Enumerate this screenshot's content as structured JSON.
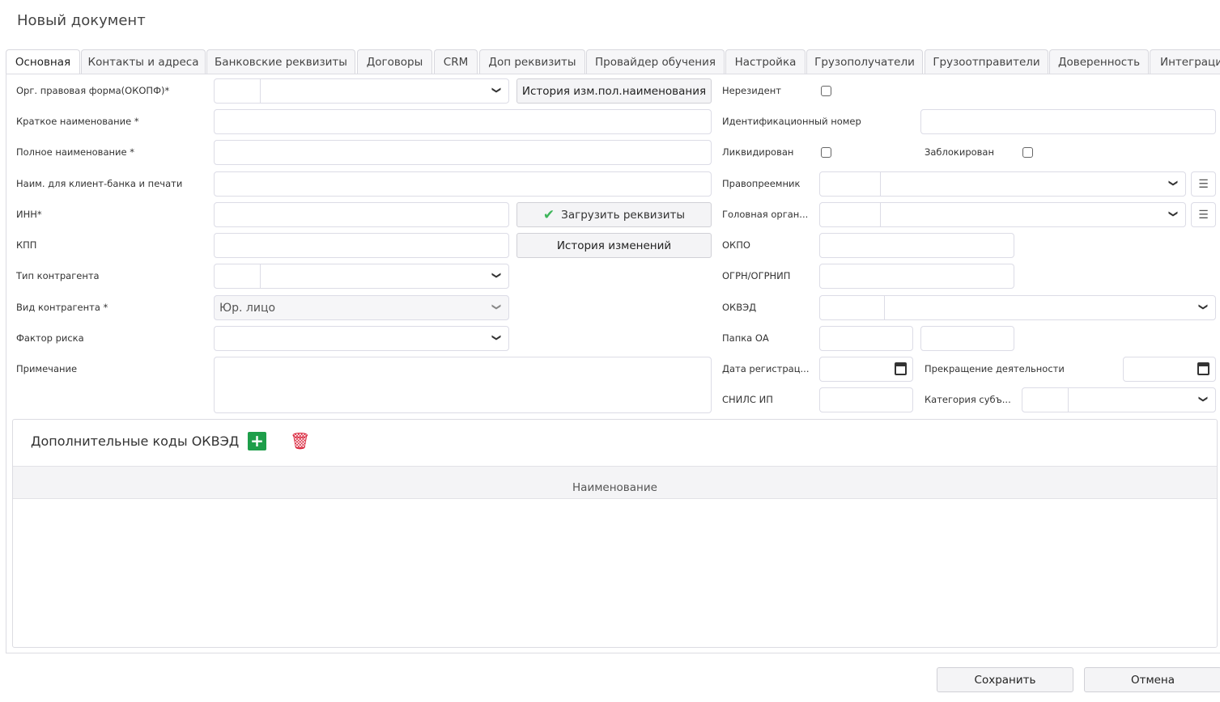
{
  "window": {
    "title": "Новый документ"
  },
  "tabs": [
    "Основная",
    "Контакты и адреса",
    "Банковские реквизиты",
    "Договоры",
    "CRM",
    "Доп реквизиты",
    "Провайдер обучения",
    "Настройка",
    "Грузополучатели",
    "Грузоотправители",
    "Доверенность",
    "Интеграци"
  ],
  "left": {
    "okopf": "Орг. правовая форма(ОКОПФ)*",
    "short_name": "Краткое наименование *",
    "full_name": "Полное наименование *",
    "bank_name": "Наим. для клиент-банка и печати",
    "inn": "ИНН*",
    "kpp": "КПП",
    "type": "Тип контрагента",
    "kind": "Вид контрагента *",
    "kind_value": "Юр. лицо",
    "risk": "Фактор риска",
    "note": "Примечание"
  },
  "buttons": {
    "name_history": "История изм.пол.наименования",
    "load": "Загрузить реквизиты",
    "history": "История изменений",
    "save": "Сохранить",
    "cancel": "Отмена"
  },
  "right": {
    "nonresident": "Нерезидент",
    "id_number": "Идентификационный номер",
    "liquidated": "Ликвидирован",
    "blocked": "Заблокирован",
    "successor": "Правопреемник",
    "head_org": "Головная орган...",
    "okpo": "ОКПО",
    "ogrn": "ОГРН/ОГРНИП",
    "okved": "ОКВЭД",
    "folder": "Папка ОА",
    "reg_date": "Дата регистрац...",
    "termination": "Прекращение деятельности",
    "snils": "СНИЛС ИП",
    "category": "Категория субъ..."
  },
  "okved_panel": {
    "title": "Дополнительные коды ОКВЭД",
    "column": "Наименование"
  },
  "colors": {
    "add": "#1e9e4a",
    "delete": "#d9233a",
    "check": "#3db55a"
  }
}
